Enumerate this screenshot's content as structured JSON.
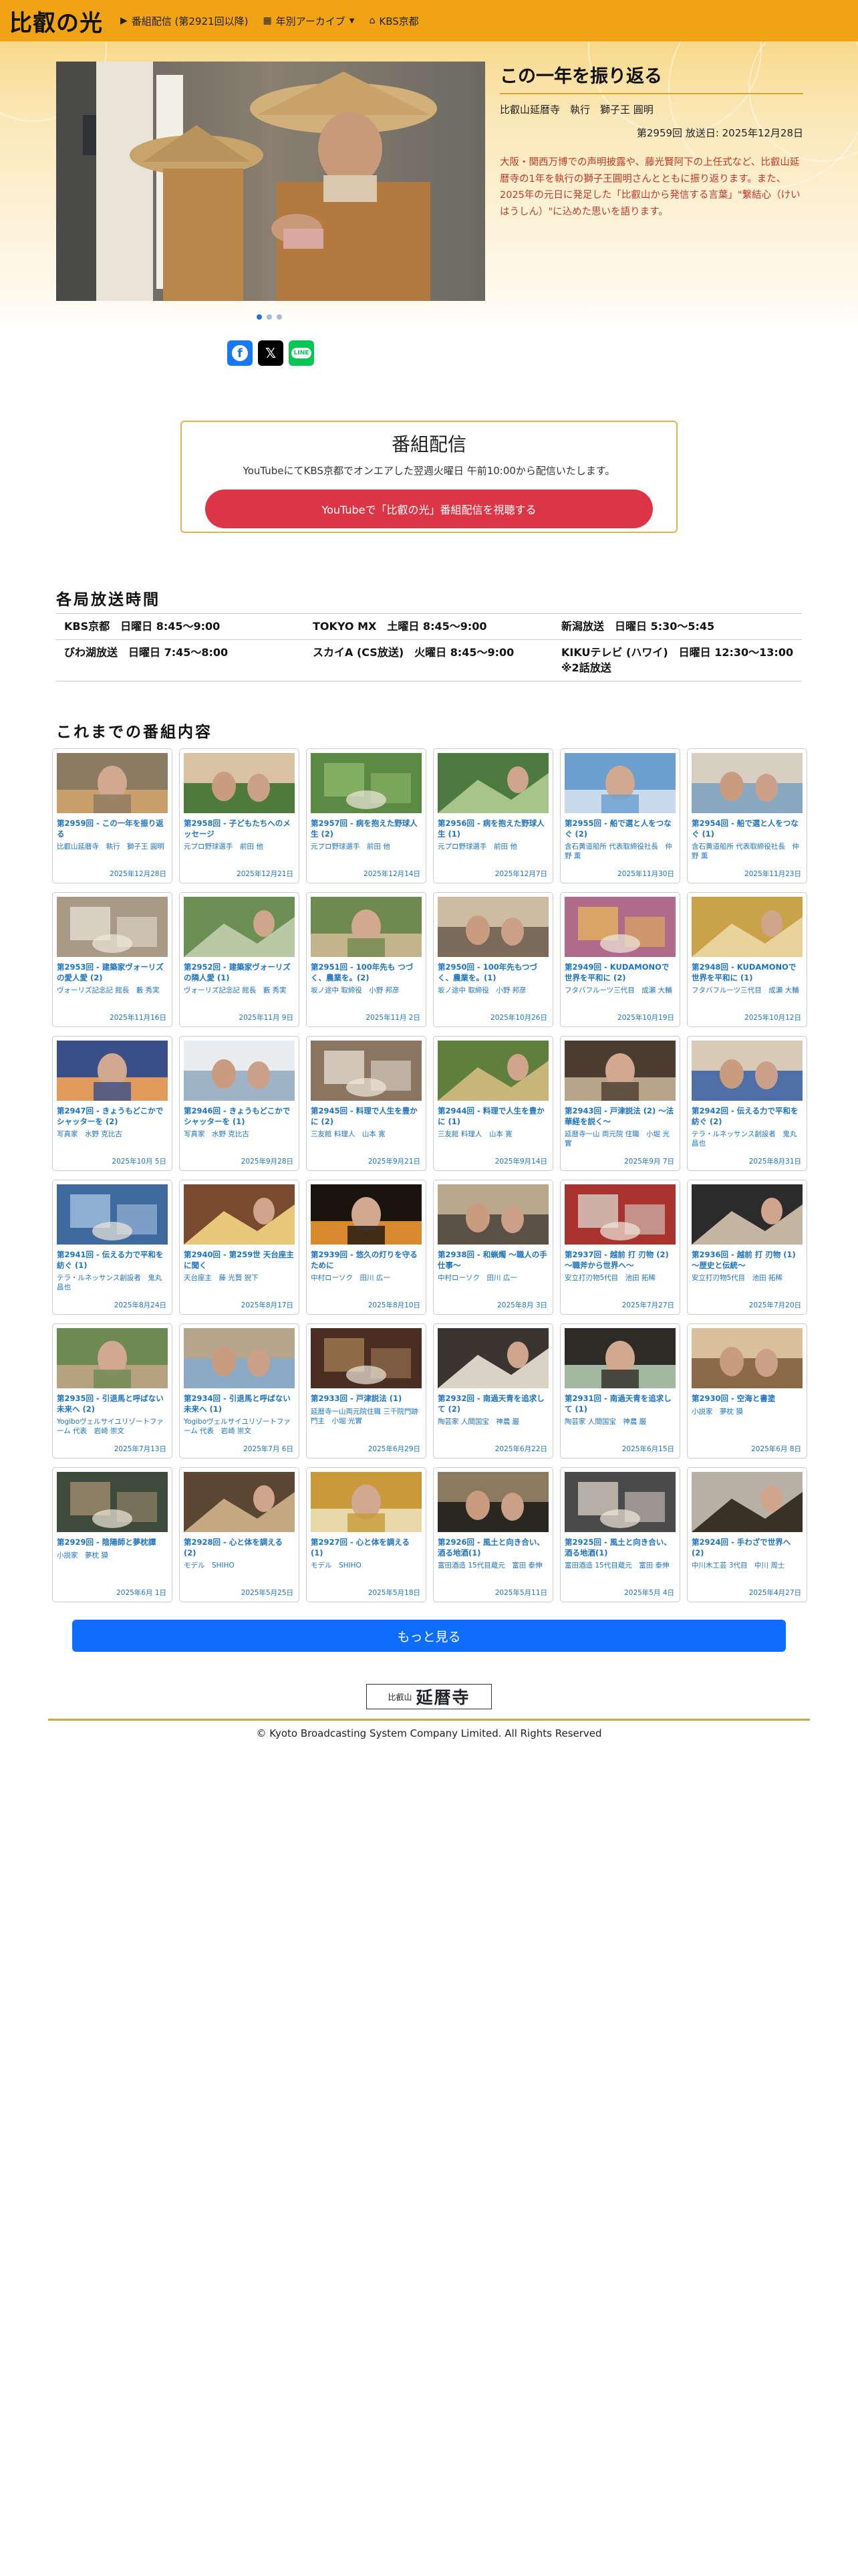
{
  "header": {
    "brand": "比叡の光",
    "nav": [
      {
        "icon": "youtube-icon",
        "glyph": "▶",
        "label": "番組配信 (第2921回以降)"
      },
      {
        "icon": "calendar-icon",
        "glyph": "▦",
        "label": "年別アーカイブ"
      },
      {
        "icon": "home-icon",
        "glyph": "⌂",
        "label": "KBS京都"
      }
    ]
  },
  "featured": {
    "title": "この一年を振り返る",
    "subtitle": "比叡山延暦寺　執行　獅子王 圓明",
    "meta": "第2959回 放送日: 2025年12月28日",
    "body": "大阪・関西万博での声明披露や、藤光賢阿下の上任式など、比叡山延暦寺の1年を執行の獅子王圓明さんとともに振り返ります。また、2025年の元日に発足した「比叡山から発信する言葉」\"繋結心（けいはうしん）\"に込めた思いを語ります。"
  },
  "streaming": {
    "title": "番組配信",
    "description": "YouTubeにてKBS京都でオンエアした翌週火曜日 午前10:00から配信いたします。",
    "button_label": "YouTubeで「比叡の光」番組配信を視聴する"
  },
  "schedule_heading": "各局放送時間",
  "schedule": [
    [
      "KBS京都　日曜日 8:45〜9:00",
      "TOKYO MX　土曜日 8:45〜9:00",
      "新潟放送　日曜日 5:30〜5:45"
    ],
    [
      "びわ湖放送　日曜日 7:45〜8:00",
      "スカイA (CS放送)　火曜日 8:45〜9:00",
      "KIKUテレビ (ハワイ)　日曜日 12:30〜13:00 ※2話放送"
    ]
  ],
  "episodes_heading": "これまでの番組内容",
  "episodes": [
    {
      "title": "第2959回 - この一年を振り返る",
      "desc": "比叡山延暦寺　執行　獅子王 圓明",
      "date": "2025年12月28日",
      "colors": [
        "#8c7a62",
        "#c9a06b"
      ]
    },
    {
      "title": "第2958回 - 子どもたちへのメッセージ",
      "desc": "元プロ野球選手　前田 他",
      "date": "2025年12月21日",
      "colors": [
        "#4e7a3c",
        "#d9c3a4"
      ]
    },
    {
      "title": "第2957回 - 病を抱えた野球人生 (2)",
      "desc": "元プロ野球選手　前田 他",
      "date": "2025年12月14日",
      "colors": [
        "#5b8a44",
        "#8fb76a"
      ]
    },
    {
      "title": "第2956回 - 病を抱えた野球人生 (1)",
      "desc": "元プロ野球選手　前田 他",
      "date": "2025年12月7日",
      "colors": [
        "#4d7a40",
        "#a7c48b"
      ]
    },
    {
      "title": "第2955回 - 船で選と人をつなぐ (2)",
      "desc": "含石黄道船所 代表取締役社長　仲野 薫",
      "date": "2025年11月30日",
      "colors": [
        "#6a9fd0",
        "#c7d9ea"
      ]
    },
    {
      "title": "第2954回 - 船で選と人をつなぐ (1)",
      "desc": "含石黄道船所 代表取締役社長　仲野 薫",
      "date": "2025年11月23日",
      "colors": [
        "#8aa7c0",
        "#d8cfc2"
      ]
    },
    {
      "title": "第2953回 - 建築家ヴォーリズの愛人愛 (2)",
      "desc": "ヴォーリズ記念記 館長　藪 秀実",
      "date": "2025年11月16日",
      "colors": [
        "#a89a86",
        "#e6ddd0"
      ]
    },
    {
      "title": "第2952回 - 建築家ヴォーリズの隣人愛 (1)",
      "desc": "ヴォーリズ記念記 館長　藪 秀実",
      "date": "2025年11月 9日",
      "colors": [
        "#6c8f55",
        "#b9c9a5"
      ]
    },
    {
      "title": "第2951回 - 100年先も つづく、農業を。(2)",
      "desc": "坂ノ途中 取締役　小野 邦彦",
      "date": "2025年11月 2日",
      "colors": [
        "#6f8a4e",
        "#c4b48c"
      ]
    },
    {
      "title": "第2950回 - 100年先もつづく、農業を。(1)",
      "desc": "坂ノ途中 取締役　小野 邦彦",
      "date": "2025年10月26日",
      "colors": [
        "#7a6a5a",
        "#cdbba3"
      ]
    },
    {
      "title": "第2949回 - KUDAMONOで世界を平和に (2)",
      "desc": "フタバフルーツ三代目　成瀬 大輔",
      "date": "2025年10月19日",
      "colors": [
        "#b06a8a",
        "#e3b35b"
      ]
    },
    {
      "title": "第2948回 - KUDAMONOで世界を平和に (1)",
      "desc": "フタバフルーツ三代目　成瀬 大輔",
      "date": "2025年10月12日",
      "colors": [
        "#c9a24a",
        "#e8d39a"
      ]
    },
    {
      "title": "第2947回 - きょうもどこかでシャッターを (2)",
      "desc": "写真家　水野 克比古",
      "date": "2025年10月 5日",
      "colors": [
        "#3a4f8a",
        "#e39b5c"
      ]
    },
    {
      "title": "第2946回 - きょうもどこかでシャッターを (1)",
      "desc": "写真家　水野 克比古",
      "date": "2025年9月28日",
      "colors": [
        "#9fb3c6",
        "#e9edf0"
      ]
    },
    {
      "title": "第2945回 - 料理で人生を豊かに (2)",
      "desc": "三友館 料理人　山本 寛",
      "date": "2025年9月21日",
      "colors": [
        "#8c7560",
        "#e3dbd0"
      ]
    },
    {
      "title": "第2944回 - 料理で人生を豊かに (1)",
      "desc": "三友館 料理人　山本 寛",
      "date": "2025年9月14日",
      "colors": [
        "#5f7f3c",
        "#c8b57a"
      ]
    },
    {
      "title": "第2943回 - 戸津説法 (2) 〜法華経を説く〜",
      "desc": "延暦寺一山 両元院 住職　小堀 光實",
      "date": "2025年9月 7日",
      "colors": [
        "#4a3c2f",
        "#b7a48a"
      ]
    },
    {
      "title": "第2942回 - 伝える力で平和を紡ぐ (2)",
      "desc": "テラ・ルネッサンス創設者　鬼丸 昌也",
      "date": "2025年8月31日",
      "colors": [
        "#4f6fa8",
        "#d8cbb8"
      ]
    },
    {
      "title": "第2941回 - 伝える力で平和を紡ぐ (1)",
      "desc": "テラ・ルネッサンス創設者　鬼丸 昌也",
      "date": "2025年8月24日",
      "colors": [
        "#3f6aa0",
        "#a5c2e0"
      ]
    },
    {
      "title": "第2940回 - 第259世 天台座主に聞く",
      "desc": "天台座主　藤 光賢 猊下",
      "date": "2025年8月17日",
      "colors": [
        "#7a4a2e",
        "#e8c67a"
      ]
    },
    {
      "title": "第2939回 - 悠久の灯りを守るために",
      "desc": "中村ローソク　田川 広一",
      "date": "2025年8月10日",
      "colors": [
        "#1a1410",
        "#d98a2e"
      ]
    },
    {
      "title": "第2938回 - 和蝋燭 〜職人の手仕事〜",
      "desc": "中村ローソク　田川 広一",
      "date": "2025年8月 3日",
      "colors": [
        "#5a5045",
        "#b8a88e"
      ]
    },
    {
      "title": "第2937回 - 越前 打 刃物 (2) 〜職斧から世界へ〜",
      "desc": "安立打刃物5代目　池田 拓稀",
      "date": "2025年7月27日",
      "colors": [
        "#a8322e",
        "#d8d0c4"
      ]
    },
    {
      "title": "第2936回 - 越前 打 刃物 (1) 〜歴史と伝統〜",
      "desc": "安立打刃物5代目　池田 拓稀",
      "date": "2025年7月20日",
      "colors": [
        "#2b2b2b",
        "#c4b5a3"
      ]
    },
    {
      "title": "第2935回 - 引退馬と呼ばない未来へ (2)",
      "desc": "Yogiboヴェルサイユリゾートファーム 代表　岩崎 崇文",
      "date": "2025年7月13日",
      "colors": [
        "#6e8a52",
        "#b6a27e"
      ]
    },
    {
      "title": "第2934回 - 引退馬と呼ばない未来へ (1)",
      "desc": "Yogiboヴェルサイユリゾートファーム 代表　岩崎 崇文",
      "date": "2025年7月 6日",
      "colors": [
        "#8aa9c4",
        "#b5a58a"
      ]
    },
    {
      "title": "第2933回 - 戸津説法 (1)",
      "desc": "延暦寺一山両元院住職 三千院門跡門主　小堀 光實",
      "date": "2025年6月29日",
      "colors": [
        "#4a2e22",
        "#a07a52"
      ]
    },
    {
      "title": "第2932回 - 南過天青を追求して (2)",
      "desc": "陶芸家 人間国宝　神農 巌",
      "date": "2025年6月22日",
      "colors": [
        "#3a3530",
        "#d9d2c6"
      ]
    },
    {
      "title": "第2931回 - 南過天青を追求して (1)",
      "desc": "陶芸家 人間国宝　神農 巌",
      "date": "2025年6月15日",
      "colors": [
        "#2e2a26",
        "#a3b8a0"
      ]
    },
    {
      "title": "第2930回 - 空海と書塗",
      "desc": "小説家　夢枕 獏",
      "date": "2025年6月 8日",
      "colors": [
        "#8c6a48",
        "#d8c09a"
      ]
    },
    {
      "title": "第2929回 - 陰陽師と夢枕譚",
      "desc": "小説家　夢枕 獏",
      "date": "2025年6月 1日",
      "colors": [
        "#3e4a3a",
        "#a08c6e"
      ]
    },
    {
      "title": "第2928回 - 心と体を調える (2)",
      "desc": "モデル　SHIHO",
      "date": "2025年5月25日",
      "colors": [
        "#5a4632",
        "#c4a882"
      ]
    },
    {
      "title": "第2927回 - 心と体を調える (1)",
      "desc": "モデル　SHIHO",
      "date": "2025年5月18日",
      "colors": [
        "#c89a3a",
        "#e8d8a8"
      ]
    },
    {
      "title": "第2926回 - 風土と向き合い、酒る地酒(1)",
      "desc": "富田酒造 15代目蔵元　富田 泰伸",
      "date": "2025年5月11日",
      "colors": [
        "#2a2620",
        "#8a7a62"
      ]
    },
    {
      "title": "第2925回 - 風土と向き合い、酒る地酒(1)",
      "desc": "富田酒造 15代目蔵元　富田 泰伸",
      "date": "2025年5月 4日",
      "colors": [
        "#4a4a4a",
        "#d0c8bc"
      ]
    },
    {
      "title": "第2924回 - 手わざで世界へ(2)",
      "desc": "中川木工芸 3代目　中川 周士",
      "date": "2025年4月27日",
      "colors": [
        "#b8b0a4",
        "#3a3026"
      ]
    }
  ],
  "more_button": "もっと見る",
  "footer": {
    "logo_small": "比叡山",
    "logo_big": "延暦寺",
    "copyright": "© Kyoto Broadcasting System Company Limited. All Rights Reserved"
  }
}
